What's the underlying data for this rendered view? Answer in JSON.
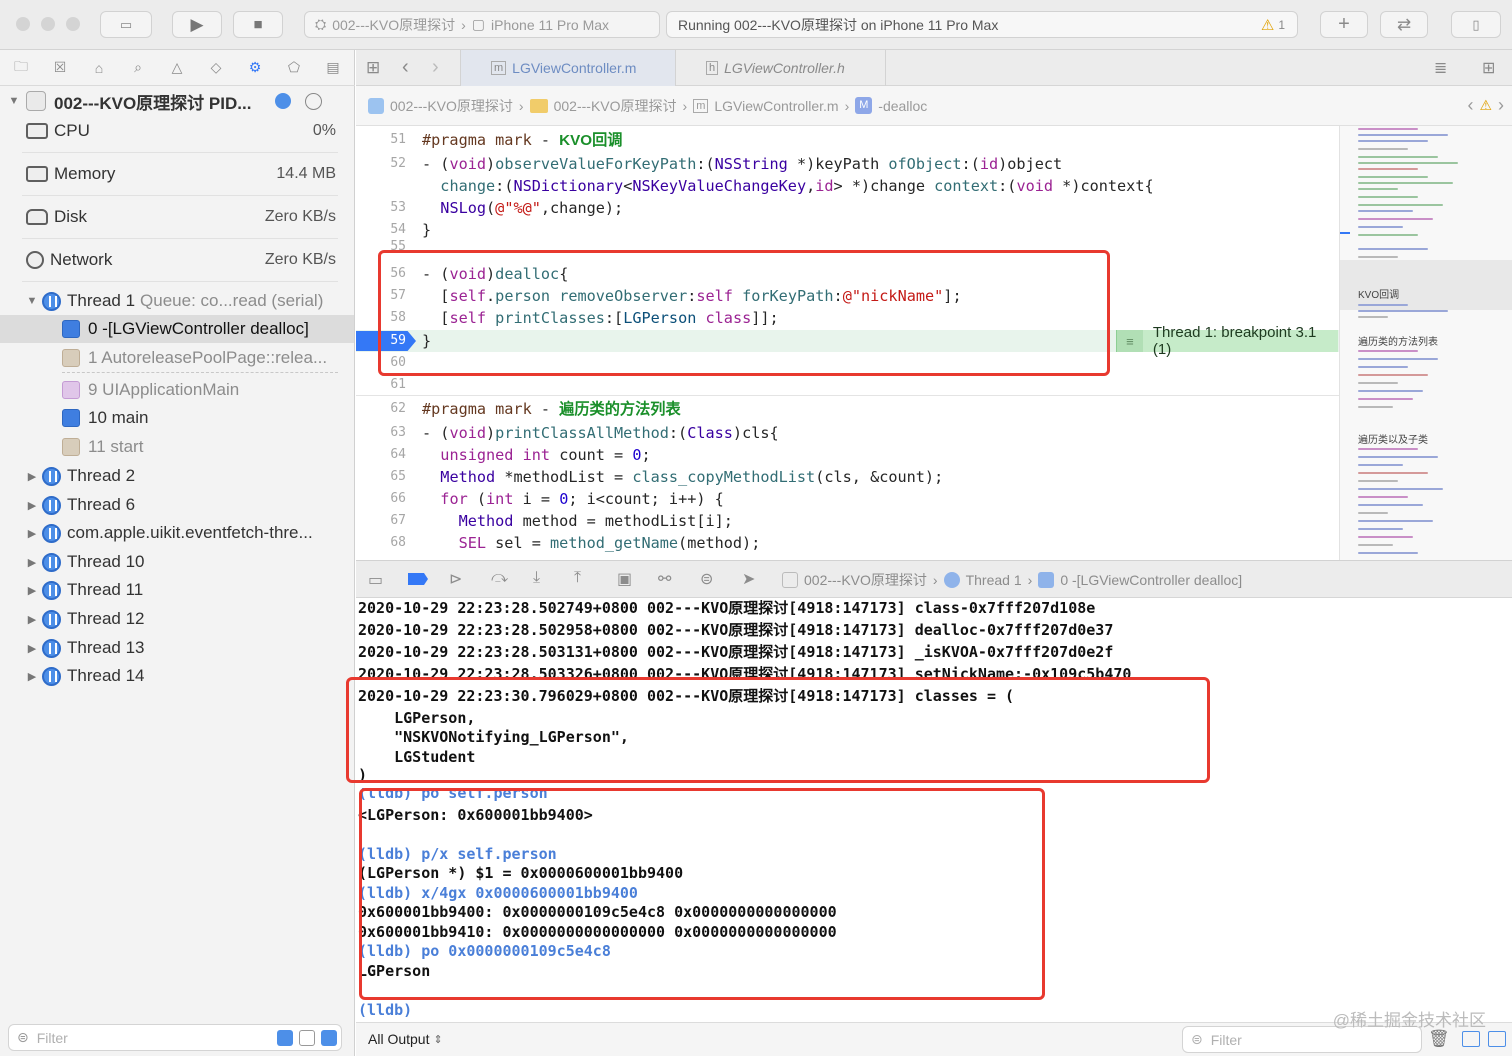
{
  "toolbar": {
    "scheme_target": "002---KVO原理探讨",
    "scheme_device": "iPhone 11 Pro Max",
    "status_text": "Running 002---KVO原理探讨 on iPhone 11 Pro Max",
    "warning_count": "1"
  },
  "navigator": {
    "process_title": "002---KVO原理探讨 PID...",
    "gauges": [
      {
        "label": "CPU",
        "value": "0%"
      },
      {
        "label": "Memory",
        "value": "14.4 MB"
      },
      {
        "label": "Disk",
        "value": "Zero KB/s"
      },
      {
        "label": "Network",
        "value": "Zero KB/s"
      }
    ],
    "thread1_label": "Thread 1",
    "thread1_queue": "Queue: co...read (serial)",
    "frames": [
      {
        "label": "0 -[LGViewController dealloc]",
        "type": "user"
      },
      {
        "label": "1 AutoreleasePoolPage::relea...",
        "type": "system"
      },
      {
        "label": "9 UIApplicationMain",
        "type": "uikit"
      },
      {
        "label": "10 main",
        "type": "user"
      },
      {
        "label": "11 start",
        "type": "system"
      }
    ],
    "threads": [
      "Thread 2",
      "Thread 6",
      "com.apple.uikit.eventfetch-thre...",
      "Thread 10",
      "Thread 11",
      "Thread 12",
      "Thread 13",
      "Thread 14"
    ],
    "filter_placeholder": "Filter"
  },
  "editor": {
    "tabs": [
      "LGViewController.m",
      "LGViewController.h"
    ],
    "breadcrumbs": [
      "002---KVO原理探讨",
      "002---KVO原理探讨",
      "LGViewController.m",
      "-dealloc"
    ],
    "breakpoint_line": "59",
    "breakpoint_label": "Thread 1: breakpoint 3.1 (1)",
    "line_numbers": [
      "51",
      "52",
      "",
      "53",
      "54",
      "55",
      "56",
      "57",
      "58",
      "59",
      "60",
      "61",
      "62",
      "63",
      "64",
      "65",
      "66",
      "67",
      "68"
    ],
    "headers": [
      "KVO回调",
      "遍历类的方法列表"
    ]
  },
  "minimap": {
    "labels": [
      "KVO回调",
      "遍历类的方法列表",
      "遍历类以及子类"
    ]
  },
  "debug_bar": {
    "crumbs": [
      "002---KVO原理探讨",
      "Thread 1",
      "0 -[LGViewController dealloc]"
    ]
  },
  "console": {
    "lines": [
      "2020-10-29 22:23:28.502749+0800 002---KVO原理探讨[4918:147173] class-0x7fff207d108e",
      "2020-10-29 22:23:28.502958+0800 002---KVO原理探讨[4918:147173] dealloc-0x7fff207d0e37",
      "2020-10-29 22:23:28.503131+0800 002---KVO原理探讨[4918:147173] _isKVOA-0x7fff207d0e2f",
      "2020-10-29 22:23:28.503326+0800 002---KVO原理探讨[4918:147173] setNickName:-0x109c5b470",
      "2020-10-29 22:23:30.796029+0800 002---KVO原理探讨[4918:147173] classes = (",
      "    LGPerson,",
      "    \"NSKVONotifying_LGPerson\",",
      "    LGStudent",
      ")",
      "(lldb) po self.person",
      "<LGPerson: 0x600001bb9400>",
      "",
      "(lldb) p/x self.person",
      "(LGPerson *) $1 = 0x0000600001bb9400",
      "(lldb) x/4gx 0x0000600001bb9400",
      "0x600001bb9400: 0x0000000109c5e4c8 0x0000000000000000",
      "0x600001bb9410: 0x0000000000000000 0x0000000000000000",
      "(lldb) po 0x0000000109c5e4c8",
      "LGPerson",
      "",
      "(lldb)"
    ],
    "output_selector": "All Output",
    "filter_placeholder": "Filter"
  },
  "watermark": "@稀土掘金技术社区",
  "colors": {
    "accent": "#3478f6",
    "highlight_box": "#e8392f",
    "breakpoint_band": "#c6ebc9"
  }
}
